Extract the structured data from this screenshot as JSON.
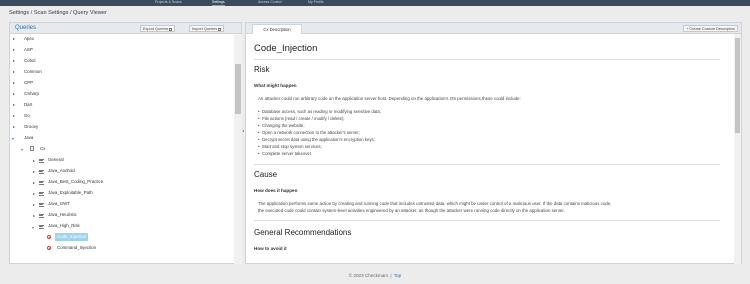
{
  "top_nav": {
    "items": [
      "Projects & Scans",
      "Settings",
      "Access Control",
      "My Profile"
    ]
  },
  "breadcrumb": "Settings / Scan Settings / Query Viewer",
  "queries_panel": {
    "title": "Queries",
    "export_label": "Export Queries",
    "import_label": "Import Queries",
    "tree": {
      "languages": [
        "Apex",
        "ASP",
        "Cobol",
        "Common",
        "CPP",
        "CSharp",
        "Dart",
        "Go",
        "Groovy",
        "Java"
      ],
      "java_child": "Cx",
      "categories": [
        "General",
        "Java_Android",
        "Java_Best_Coding_Practice",
        "Java_Exploitable_Path",
        "Java_GWT",
        "Java_Heuristic",
        "Java_High_Risk"
      ],
      "high_risk_queries": [
        "Code_Injection",
        "Command_Injection"
      ]
    }
  },
  "description_panel": {
    "tab_label": "Cx Description",
    "create_label": "Create Custom Description",
    "title": "Code_Injection",
    "risk": {
      "heading": "Risk",
      "subheading": "What might happen",
      "intro": "An attacker could run arbitrary code on the application server host. Depending on the application's OS permissions,these could include:",
      "bullets": [
        "Database access, such as reading or modifying sensitive data;",
        "File actions (read / create / modify / delete);",
        "Changing the website;",
        "Open a network connection to the attacker's server;",
        "Decrypt secret data using the application's encryption keys;",
        "Start and stop system services;",
        "Complete server takeover."
      ]
    },
    "cause": {
      "heading": "Cause",
      "subheading": "How does it happen",
      "line1": "The application performs some action by creating and running code that includes untrusted data, which might be under control of a malicious user. If the data contains malicious code,",
      "line2": "the executed code could contain system-level activities engineered by an attacker, as though the attacker were running code directly on the application server."
    },
    "recommendations": {
      "heading": "General Recommendations",
      "subheading": "How to avoid it"
    }
  },
  "footer": {
    "copyright": "© 2023 Checkmarx",
    "separator": "|",
    "top_link": "Top"
  },
  "colors": {
    "accent": "#2f6fa8",
    "selection": "#9fd3ec",
    "error": "#d23a3a",
    "topbar": "#3b4a5e"
  }
}
